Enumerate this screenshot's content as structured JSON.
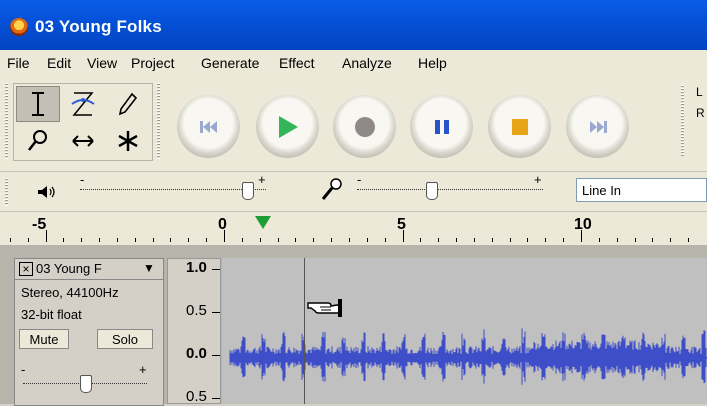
{
  "window": {
    "title": "03 Young Folks"
  },
  "menu": [
    "File",
    "Edit",
    "View",
    "Project",
    "Generate",
    "Effect",
    "Analyze",
    "Help"
  ],
  "tools": [
    "selection-tool",
    "envelope-tool",
    "draw-tool",
    "zoom-tool",
    "timeshift-tool",
    "multi-tool"
  ],
  "transport": [
    "skip-to-start",
    "play",
    "record",
    "pause",
    "stop",
    "skip-to-end"
  ],
  "meter": {
    "left_label": "L",
    "right_label": "R"
  },
  "mixer": {
    "output_minus": "-",
    "output_plus": "+",
    "input_minus": "-",
    "input_plus": "+",
    "output_level": 0.9,
    "input_level": 0.4,
    "input_source": "Line In"
  },
  "ruler": {
    "labels": [
      "-5",
      "0",
      "5",
      "10"
    ],
    "play_position": 1.1
  },
  "track": {
    "name": "03 Young F",
    "format": "Stereo, 44100Hz",
    "sample": "32-bit float",
    "mute": "Mute",
    "solo": "Solo",
    "gain_minus": "-",
    "gain_plus": "+",
    "gain_level": 0.5,
    "vruler": [
      "1.0",
      "0.5",
      "0.0",
      "0.5"
    ]
  },
  "colors": {
    "waveform": "#3d4ec8",
    "titlebar": "#0450d6",
    "playhead": "#1e9e32"
  }
}
